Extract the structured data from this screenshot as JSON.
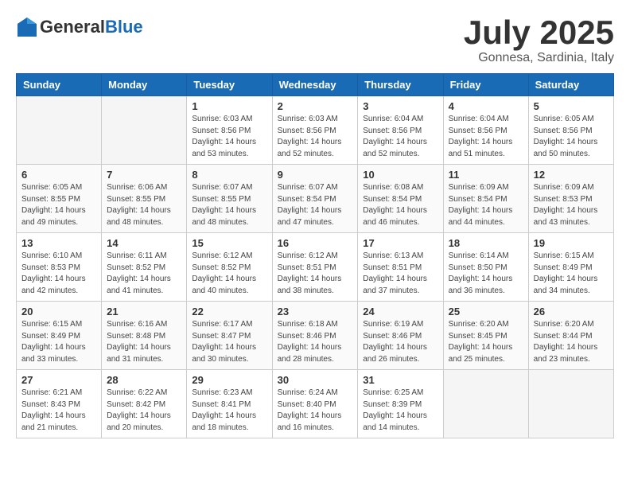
{
  "header": {
    "logo_general": "General",
    "logo_blue": "Blue",
    "month_title": "July 2025",
    "location": "Gonnesa, Sardinia, Italy"
  },
  "days_of_week": [
    "Sunday",
    "Monday",
    "Tuesday",
    "Wednesday",
    "Thursday",
    "Friday",
    "Saturday"
  ],
  "weeks": [
    [
      {
        "day": "",
        "info": ""
      },
      {
        "day": "",
        "info": ""
      },
      {
        "day": "1",
        "info": "Sunrise: 6:03 AM\nSunset: 8:56 PM\nDaylight: 14 hours and 53 minutes."
      },
      {
        "day": "2",
        "info": "Sunrise: 6:03 AM\nSunset: 8:56 PM\nDaylight: 14 hours and 52 minutes."
      },
      {
        "day": "3",
        "info": "Sunrise: 6:04 AM\nSunset: 8:56 PM\nDaylight: 14 hours and 52 minutes."
      },
      {
        "day": "4",
        "info": "Sunrise: 6:04 AM\nSunset: 8:56 PM\nDaylight: 14 hours and 51 minutes."
      },
      {
        "day": "5",
        "info": "Sunrise: 6:05 AM\nSunset: 8:56 PM\nDaylight: 14 hours and 50 minutes."
      }
    ],
    [
      {
        "day": "6",
        "info": "Sunrise: 6:05 AM\nSunset: 8:55 PM\nDaylight: 14 hours and 49 minutes."
      },
      {
        "day": "7",
        "info": "Sunrise: 6:06 AM\nSunset: 8:55 PM\nDaylight: 14 hours and 48 minutes."
      },
      {
        "day": "8",
        "info": "Sunrise: 6:07 AM\nSunset: 8:55 PM\nDaylight: 14 hours and 48 minutes."
      },
      {
        "day": "9",
        "info": "Sunrise: 6:07 AM\nSunset: 8:54 PM\nDaylight: 14 hours and 47 minutes."
      },
      {
        "day": "10",
        "info": "Sunrise: 6:08 AM\nSunset: 8:54 PM\nDaylight: 14 hours and 46 minutes."
      },
      {
        "day": "11",
        "info": "Sunrise: 6:09 AM\nSunset: 8:54 PM\nDaylight: 14 hours and 44 minutes."
      },
      {
        "day": "12",
        "info": "Sunrise: 6:09 AM\nSunset: 8:53 PM\nDaylight: 14 hours and 43 minutes."
      }
    ],
    [
      {
        "day": "13",
        "info": "Sunrise: 6:10 AM\nSunset: 8:53 PM\nDaylight: 14 hours and 42 minutes."
      },
      {
        "day": "14",
        "info": "Sunrise: 6:11 AM\nSunset: 8:52 PM\nDaylight: 14 hours and 41 minutes."
      },
      {
        "day": "15",
        "info": "Sunrise: 6:12 AM\nSunset: 8:52 PM\nDaylight: 14 hours and 40 minutes."
      },
      {
        "day": "16",
        "info": "Sunrise: 6:12 AM\nSunset: 8:51 PM\nDaylight: 14 hours and 38 minutes."
      },
      {
        "day": "17",
        "info": "Sunrise: 6:13 AM\nSunset: 8:51 PM\nDaylight: 14 hours and 37 minutes."
      },
      {
        "day": "18",
        "info": "Sunrise: 6:14 AM\nSunset: 8:50 PM\nDaylight: 14 hours and 36 minutes."
      },
      {
        "day": "19",
        "info": "Sunrise: 6:15 AM\nSunset: 8:49 PM\nDaylight: 14 hours and 34 minutes."
      }
    ],
    [
      {
        "day": "20",
        "info": "Sunrise: 6:15 AM\nSunset: 8:49 PM\nDaylight: 14 hours and 33 minutes."
      },
      {
        "day": "21",
        "info": "Sunrise: 6:16 AM\nSunset: 8:48 PM\nDaylight: 14 hours and 31 minutes."
      },
      {
        "day": "22",
        "info": "Sunrise: 6:17 AM\nSunset: 8:47 PM\nDaylight: 14 hours and 30 minutes."
      },
      {
        "day": "23",
        "info": "Sunrise: 6:18 AM\nSunset: 8:46 PM\nDaylight: 14 hours and 28 minutes."
      },
      {
        "day": "24",
        "info": "Sunrise: 6:19 AM\nSunset: 8:46 PM\nDaylight: 14 hours and 26 minutes."
      },
      {
        "day": "25",
        "info": "Sunrise: 6:20 AM\nSunset: 8:45 PM\nDaylight: 14 hours and 25 minutes."
      },
      {
        "day": "26",
        "info": "Sunrise: 6:20 AM\nSunset: 8:44 PM\nDaylight: 14 hours and 23 minutes."
      }
    ],
    [
      {
        "day": "27",
        "info": "Sunrise: 6:21 AM\nSunset: 8:43 PM\nDaylight: 14 hours and 21 minutes."
      },
      {
        "day": "28",
        "info": "Sunrise: 6:22 AM\nSunset: 8:42 PM\nDaylight: 14 hours and 20 minutes."
      },
      {
        "day": "29",
        "info": "Sunrise: 6:23 AM\nSunset: 8:41 PM\nDaylight: 14 hours and 18 minutes."
      },
      {
        "day": "30",
        "info": "Sunrise: 6:24 AM\nSunset: 8:40 PM\nDaylight: 14 hours and 16 minutes."
      },
      {
        "day": "31",
        "info": "Sunrise: 6:25 AM\nSunset: 8:39 PM\nDaylight: 14 hours and 14 minutes."
      },
      {
        "day": "",
        "info": ""
      },
      {
        "day": "",
        "info": ""
      }
    ]
  ]
}
